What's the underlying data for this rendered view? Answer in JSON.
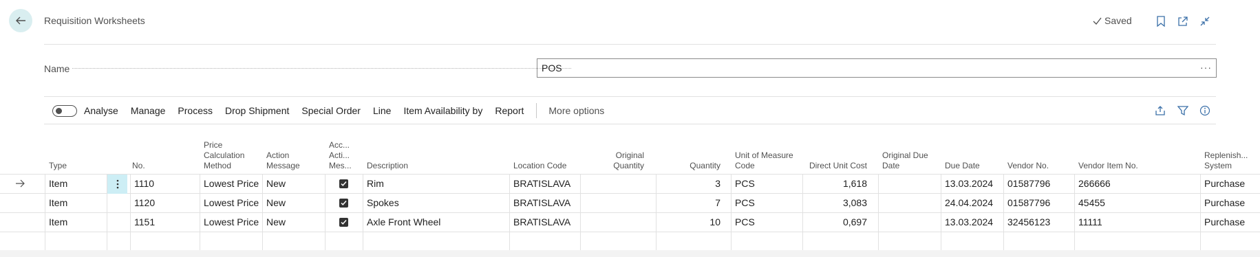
{
  "header": {
    "title": "Requisition Worksheets",
    "saved_label": "Saved"
  },
  "name_field": {
    "label": "Name",
    "value": "POS"
  },
  "actions": {
    "toggle_label": "Analyse",
    "items": [
      "Manage",
      "Process",
      "Drop Shipment",
      "Special Order",
      "Line",
      "Item Availability by",
      "Report"
    ],
    "more": "More options"
  },
  "columns": {
    "type": "Type",
    "no": "No.",
    "price_calc": "Price Calculation Method",
    "action_message": "Action Message",
    "accept_action": "Acc... Acti... Mes...",
    "description": "Description",
    "location_code": "Location Code",
    "original_quantity": "Original Quantity",
    "quantity": "Quantity",
    "uom": "Unit of Measure Code",
    "direct_unit_cost": "Direct Unit Cost",
    "original_due_date": "Original Due Date",
    "due_date": "Due Date",
    "vendor_no": "Vendor No.",
    "vendor_item_no": "Vendor Item No.",
    "replenish": "Replenish... System"
  },
  "rows": [
    {
      "type": "Item",
      "no": "1110",
      "price_calc": "Lowest Price",
      "action_message": "New",
      "accept": true,
      "description": "Rim",
      "location_code": "BRATISLAVA",
      "original_quantity": "",
      "quantity": "3",
      "uom": "PCS",
      "direct_unit_cost": "1,618",
      "original_due_date": "",
      "due_date": "13.03.2024",
      "vendor_no": "01587796",
      "vendor_item_no": "266666",
      "replenish": "Purchase"
    },
    {
      "type": "Item",
      "no": "1120",
      "price_calc": "Lowest Price",
      "action_message": "New",
      "accept": true,
      "description": "Spokes",
      "location_code": "BRATISLAVA",
      "original_quantity": "",
      "quantity": "7",
      "uom": "PCS",
      "direct_unit_cost": "3,083",
      "original_due_date": "",
      "due_date": "24.04.2024",
      "vendor_no": "01587796",
      "vendor_item_no": "45455",
      "replenish": "Purchase"
    },
    {
      "type": "Item",
      "no": "1151",
      "price_calc": "Lowest Price",
      "action_message": "New",
      "accept": true,
      "description": "Axle Front Wheel",
      "location_code": "BRATISLAVA",
      "original_quantity": "",
      "quantity": "10",
      "uom": "PCS",
      "direct_unit_cost": "0,697",
      "original_due_date": "",
      "due_date": "13.03.2024",
      "vendor_no": "32456123",
      "vendor_item_no": "11111",
      "replenish": "Purchase"
    }
  ],
  "colors": {
    "accent": "#cdeef5",
    "back_button_bg": "#d9eef0",
    "border": "#e1e1e1"
  }
}
